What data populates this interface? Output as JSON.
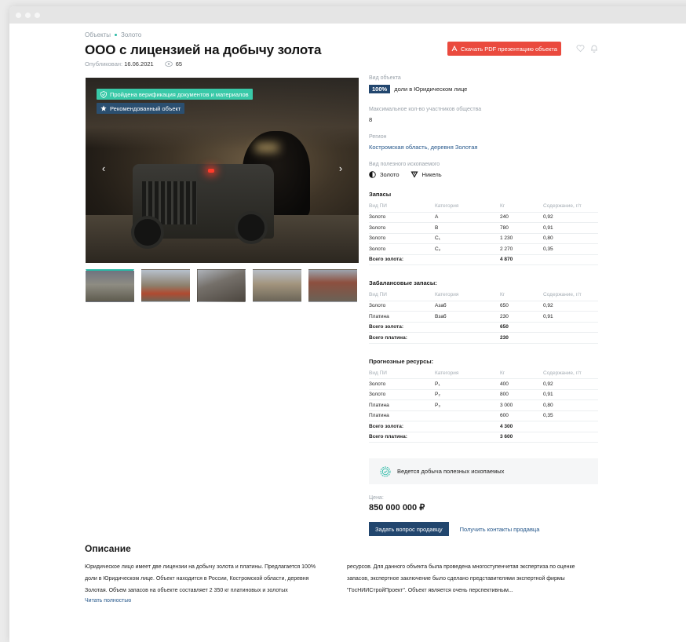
{
  "breadcrumb": {
    "items": [
      "Объекты",
      "Золото"
    ]
  },
  "title": "ООО с лицензией на добычу золота",
  "meta": {
    "published_label": "Опубликован:",
    "published_date": "16.06.2021",
    "views": "65"
  },
  "pdf_button": "Скачать PDF презентацию объекта",
  "badges": {
    "verified": "Пройдена верификация документов и материалов",
    "recommended": "Рекомендованный объект"
  },
  "info": {
    "type_label": "Вид объекта",
    "share_value": "100%",
    "share_text": "доли в Юридическом лице",
    "max_participants_label": "Максимальное кол-во участников общества",
    "max_participants": "8",
    "region_label": "Регион",
    "region": "Костромская область, деревня Золотая",
    "mineral_label": "Вид полезного ископаемого",
    "minerals": [
      "Золото",
      "Никель"
    ]
  },
  "reserves": {
    "title": "Запасы",
    "headers": [
      "Вид ПИ",
      "Категория",
      "Кг",
      "Содержание, г/т"
    ],
    "rows": [
      [
        "Золото",
        "А",
        "240",
        "0,92"
      ],
      [
        "Золото",
        "В",
        "780",
        "0,91"
      ],
      [
        "Золото",
        "С₁",
        "1 230",
        "0,80"
      ],
      [
        "Золото",
        "С₂",
        "2 270",
        "0,35"
      ]
    ],
    "totals": [
      [
        "Всего золота:",
        "4 870"
      ]
    ]
  },
  "offbalance": {
    "title": "Забалансовые запасы:",
    "headers": [
      "Вид ПИ",
      "Категория",
      "Кг",
      "Содержание, г/т"
    ],
    "rows": [
      [
        "Золото",
        "Азаб",
        "650",
        "0,92"
      ],
      [
        "Платина",
        "Взаб",
        "230",
        "0,91"
      ]
    ],
    "totals": [
      [
        "Всего золота:",
        "650"
      ],
      [
        "Всего платина:",
        "230"
      ]
    ]
  },
  "forecast": {
    "title": "Прогнозные ресурсы:",
    "headers": [
      "Вид ПИ",
      "Категория",
      "Кг",
      "Содержание, г/т"
    ],
    "rows": [
      [
        "Золото",
        "P₁",
        "400",
        "0,92"
      ],
      [
        "Золото",
        "P₂",
        "800",
        "0,91"
      ],
      [
        "Платина",
        "P₃",
        "3 000",
        "0,80"
      ],
      [
        "Платина",
        "",
        "600",
        "0,35"
      ]
    ],
    "totals": [
      [
        "Всего золота:",
        "4 300"
      ],
      [
        "Всего платина:",
        "3 600"
      ]
    ]
  },
  "status": "Ведется добыча полезных ископаемых",
  "price": {
    "label": "Цена:",
    "value": "850 000 000 ₽"
  },
  "actions": {
    "ask": "Задать вопрос продавцу",
    "contacts": "Получить контакты продавца"
  },
  "description": {
    "title": "Описание",
    "col1": "Юридическое лицо имеет две лицензии на добычу золота и платины. Предлагается 100% доли в Юридическом лице. Объект находится в России, Костромской области, деревня Золотая. Объем запасов на объекте составляет 2 350 кг платиновых и золотых",
    "col2": "ресурсов. Для данного объекта была проведена многоступенчетая экспертиза по оценке запасов, экспертное заключение было сделано представителями экспертной фирмы \"ГосНИИСтройПроект\". Объект является очень перспективным...",
    "read_more": "Читать полностью"
  },
  "colors": {
    "accent": "#2ab9a6",
    "primary": "#22466e",
    "pdf": "#ea4a3e"
  }
}
